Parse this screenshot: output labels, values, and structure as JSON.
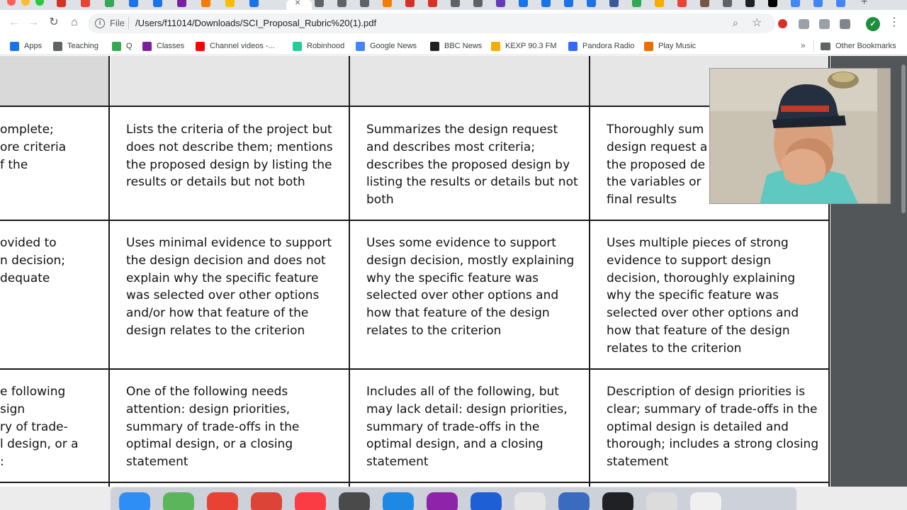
{
  "browser": {
    "url_scheme": "File",
    "url": "/Users/f11014/Downloads/SCI_Proposal_Rubric%20(1).pdf",
    "profile_initial": "✓",
    "tab_icons": [
      "#d93025",
      "#ea4335",
      "#34a853",
      "#1a73e8",
      "#1a73e8",
      "#7b1fa2",
      "#f57c00",
      "#fbbc04",
      "#1a73e8"
    ],
    "tab_icons_right": [
      "#5f6368",
      "#5f6368",
      "#5f6368",
      "#f57c00",
      "#d93025",
      "#d93025",
      "#5f6368",
      "#5f6368",
      "#673ab7",
      "#1a73e8",
      "#1a73e8",
      "#1a73e8",
      "#1a73e8",
      "#3b5998",
      "#34a853",
      "#f9ab00",
      "#ea4335",
      "#795548",
      "#5f6368",
      "#202124",
      "#000000",
      "#4285f4",
      "#4285f4",
      "#4285f4"
    ]
  },
  "bookmarks": [
    {
      "label": "Apps",
      "icon": "apps-grid-icon",
      "color": "#1a73e8"
    },
    {
      "label": "Teaching",
      "icon": "folder-icon",
      "color": "#5f6368"
    },
    {
      "label": "Q",
      "icon": "q-icon",
      "color": "#34a853"
    },
    {
      "label": "Classes",
      "icon": "classes-icon",
      "color": "#7b1fa2"
    },
    {
      "label": "Channel videos -...",
      "icon": "youtube-icon",
      "color": "#ff0000"
    },
    {
      "label": "Robinhood",
      "icon": "feather-icon",
      "color": "#21ce99"
    },
    {
      "label": "Google News",
      "icon": "news-icon",
      "color": "#4285f4"
    },
    {
      "label": "BBC News",
      "icon": "bbc-icon",
      "color": "#202124"
    },
    {
      "label": "KEXP 90.3 FM",
      "icon": "kexp-icon",
      "color": "#f9ab00"
    },
    {
      "label": "Pandora Radio",
      "icon": "pandora-icon",
      "color": "#3668ff"
    },
    {
      "label": "Play Music",
      "icon": "play-music-icon",
      "color": "#ef6c00"
    }
  ],
  "other_bookmarks": "Other Bookmarks",
  "rubric": {
    "row1": [
      [
        "omplete;",
        "ore criteria",
        "f the"
      ],
      "Lists the criteria of the project but does not describe them; mentions the proposed design by listing the results or details but not both",
      "Summarizes the design request and describes most criteria; describes the proposed design by listing the results or details but not both",
      [
        "Thoroughly sum",
        "design request a",
        "the proposed de",
        "the variables or",
        "final results"
      ]
    ],
    "row2": [
      [
        "ovided to",
        "n decision;",
        "dequate"
      ],
      "Uses minimal evidence to support the design decision and does not explain why the specific feature was selected over other options and/or how that feature of the design relates to the criterion",
      "Uses some evidence to support design decision, mostly explaining why the specific feature was selected over other options and how that feature of the design relates to the criterion",
      "Uses multiple pieces of strong evidence to support design decision, thoroughly explaining why the specific feature was selected over other options and how that feature of the design relates to the criterion"
    ],
    "row3": [
      [
        "e following",
        "sign",
        "ry of trade-",
        "l design, or a",
        ":"
      ],
      "One of the following needs attention: design priorities, summary of trade-offs in the optimal design, or a closing statement",
      "Includes all of the following, but may lack detail: design priorities, summary of trade-offs in the optimal design, and a closing statement",
      "Description of design priorities is clear; summary of trade-offs in the optimal design is detailed and thorough; includes a strong closing statement"
    ]
  },
  "dock_colors": [
    "#2f8ef5",
    "#5bb55b",
    "#e94235",
    "#db4437",
    "#fc3c44",
    "#4a4a4a",
    "#1e88e5",
    "#8e24aa",
    "#1f5fd6",
    "#e5e5e5",
    "#3b6bbf",
    "#202124",
    "#dcdcdc",
    "#f0f0f0"
  ]
}
